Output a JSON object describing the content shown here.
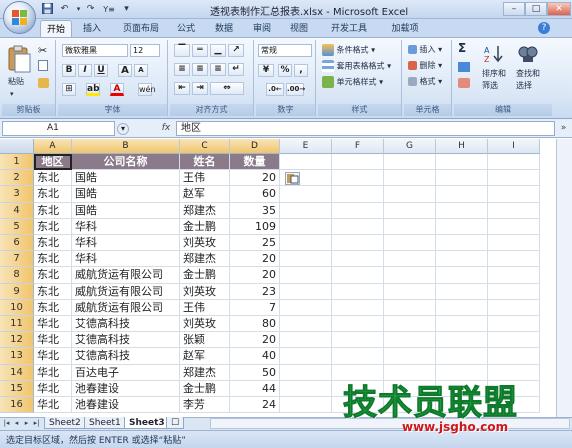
{
  "window": {
    "title": "透视表制作汇总报表.xlsx - Microsoft Excel",
    "min_label": "–",
    "max_label": "□",
    "close_label": "✕"
  },
  "qat": {
    "save_icon": "save-icon",
    "undo_label": "↶",
    "redo_label": "↷",
    "custom_label": "▾"
  },
  "tabs": [
    {
      "label": "开始"
    },
    {
      "label": "插入"
    },
    {
      "label": "页面布局"
    },
    {
      "label": "公式"
    },
    {
      "label": "数据"
    },
    {
      "label": "审阅"
    },
    {
      "label": "视图"
    },
    {
      "label": "开发工具"
    },
    {
      "label": "加载项"
    }
  ],
  "ribbon": {
    "clipboard": {
      "label": "剪贴板",
      "paste": "粘贴"
    },
    "font": {
      "label": "字体",
      "family": "微软雅黑",
      "size": "12",
      "bold": "B",
      "italic": "I",
      "underline": "U",
      "grow": "A",
      "shrink": "A",
      "font_color": "A",
      "highlight": "ab"
    },
    "alignment": {
      "label": "对齐方式"
    },
    "number": {
      "label": "数字",
      "format": "常规",
      "percent": "%",
      "comma": ",",
      "currency": "¥"
    },
    "styles": {
      "label": "样式",
      "conditional": "条件格式",
      "table": "套用表格格式",
      "cell": "单元格样式"
    },
    "cells": {
      "label": "单元格",
      "insert": "插入",
      "delete": "删除",
      "format": "格式"
    },
    "editing": {
      "label": "编辑",
      "sigma": "Σ",
      "sort": "排序和",
      "sort2": "筛选",
      "find": "查找和",
      "find2": "选择"
    }
  },
  "formula_bar": {
    "name_box": "A1",
    "fx": "fx",
    "content": "地区"
  },
  "columns": [
    "A",
    "B",
    "C",
    "D",
    "E",
    "F",
    "G",
    "H",
    "I"
  ],
  "header_row": [
    "地区",
    "公司名称",
    "姓名",
    "数量"
  ],
  "rows": [
    [
      "东北",
      "国皓",
      "王伟",
      "20"
    ],
    [
      "东北",
      "国皓",
      "赵军",
      "60"
    ],
    [
      "东北",
      "国皓",
      "郑建杰",
      "35"
    ],
    [
      "东北",
      "华科",
      "金士鹏",
      "109"
    ],
    [
      "东北",
      "华科",
      "刘英玫",
      "25"
    ],
    [
      "东北",
      "华科",
      "郑建杰",
      "20"
    ],
    [
      "东北",
      "威航货运有限公司",
      "金士鹏",
      "20"
    ],
    [
      "东北",
      "威航货运有限公司",
      "刘英玫",
      "23"
    ],
    [
      "东北",
      "威航货运有限公司",
      "王伟",
      "7"
    ],
    [
      "华北",
      "艾德高科技",
      "刘英玫",
      "80"
    ],
    [
      "华北",
      "艾德高科技",
      "张颖",
      "20"
    ],
    [
      "华北",
      "艾德高科技",
      "赵军",
      "40"
    ],
    [
      "华北",
      "百达电子",
      "郑建杰",
      "50"
    ],
    [
      "华北",
      "池春建设",
      "金士鹏",
      "44"
    ],
    [
      "华北",
      "池春建设",
      "李芳",
      "24"
    ]
  ],
  "sheets": [
    {
      "name": "Sheet2"
    },
    {
      "name": "Sheet1"
    },
    {
      "name": "Sheet3"
    }
  ],
  "status": "选定目标区域，然后按 ENTER 或选择“粘贴”",
  "watermark": {
    "text": "技术员联盟",
    "url": "www.jsgho.com"
  },
  "colors": {
    "header_fill": "#8a7a8a",
    "accent": "#f1c56c",
    "ribbon": "#dbe7f6"
  }
}
